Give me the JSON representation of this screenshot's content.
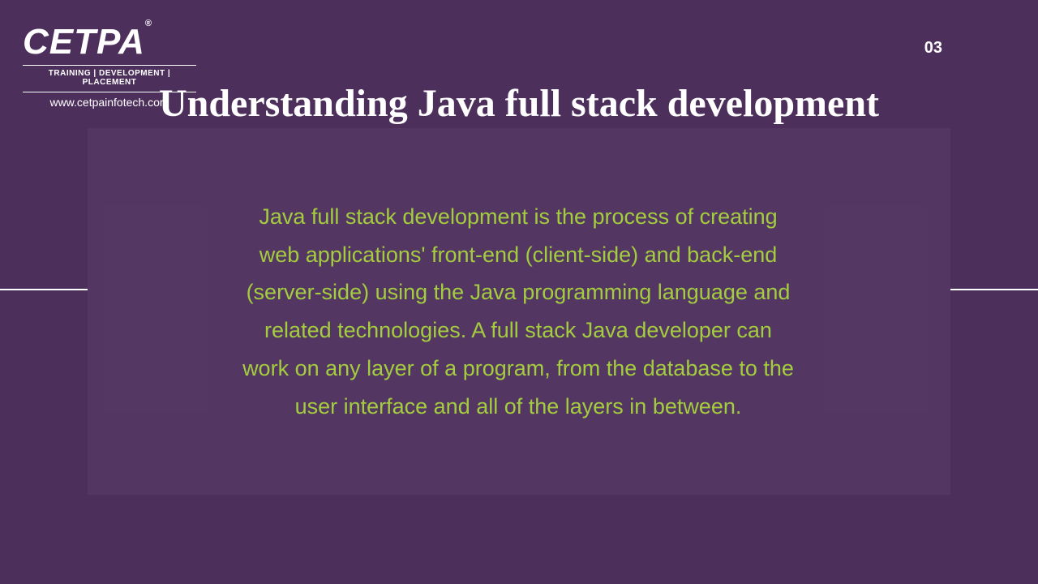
{
  "logo": {
    "name": "CETPA",
    "registered": "®",
    "tagline": "TRAINING | DEVELOPMENT | PLACEMENT",
    "url": "www.cetpainfotech.com"
  },
  "page_number": "03",
  "title": "Understanding Java full stack development",
  "body": "Java full stack development is the process of creating web applications' front-end (client-side) and back-end (server-side) using the Java programming language and related technologies. A full stack Java developer can work on any layer of a program, from the database to the user interface and all of the layers in between."
}
